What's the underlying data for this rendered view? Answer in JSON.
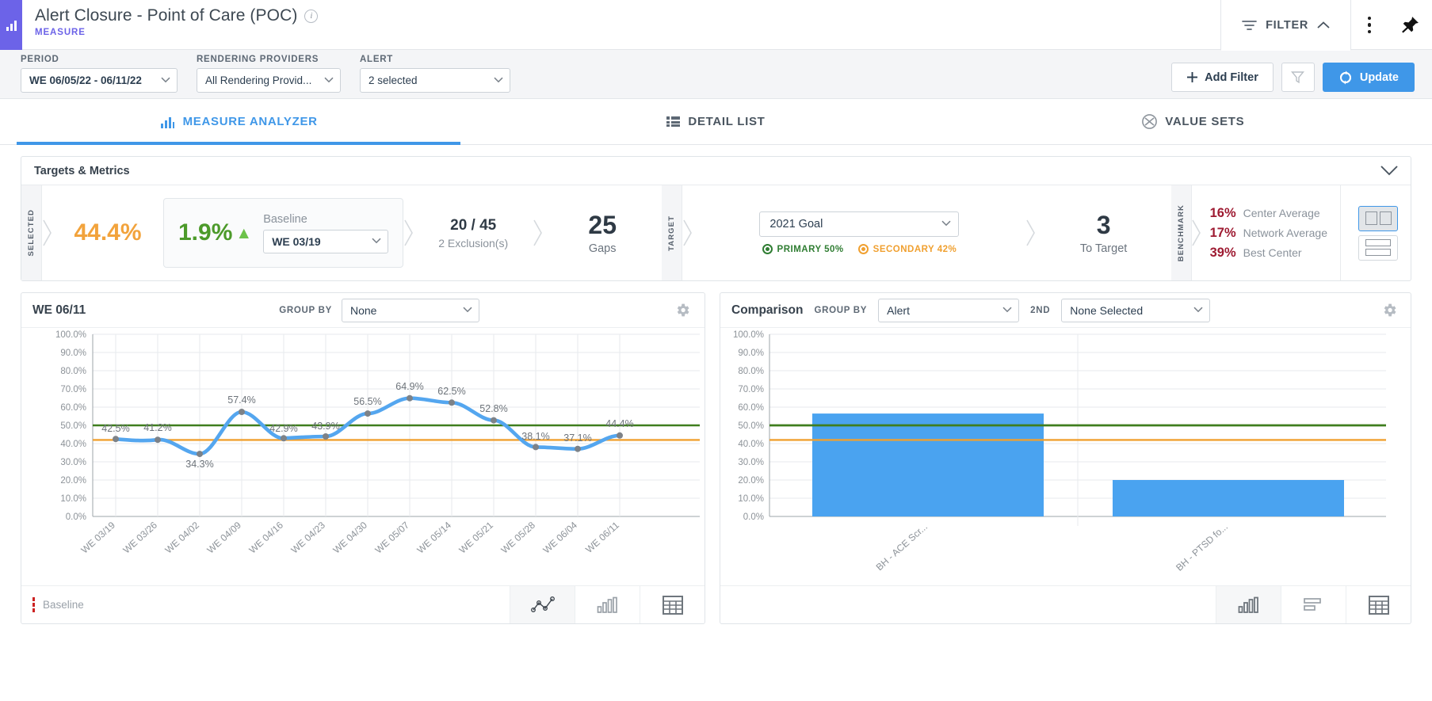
{
  "header": {
    "title": "Alert Closure - Point of Care (POC)",
    "subtitle": "MEASURE",
    "info_icon": "info-icon",
    "app_icon": "bar-chart-icon",
    "filter_tab_label": "FILTER",
    "filter_tab_icon": "filter-lines-icon",
    "filter_collapse_icon": "chevron-up-icon",
    "more_icon": "kebab-menu-icon",
    "pin_icon": "pin-icon"
  },
  "filterbar": {
    "period_label": "PERIOD",
    "period_value": "WE 06/05/22 - 06/11/22",
    "providers_label": "RENDERING PROVIDERS",
    "providers_value": "All Rendering Provid...",
    "alert_label": "ALERT",
    "alert_value": "2 selected",
    "add_filter_label": "Add Filter",
    "add_filter_icon": "plus-icon",
    "funnel_icon": "funnel-icon",
    "update_label": "Update",
    "update_icon": "refresh-icon"
  },
  "tabs": [
    {
      "label": "MEASURE ANALYZER",
      "icon": "bar-chart-icon",
      "active": true
    },
    {
      "label": "DETAIL LIST",
      "icon": "list-icon",
      "active": false
    },
    {
      "label": "VALUE SETS",
      "icon": "value-sets-icon",
      "active": false
    }
  ],
  "targets": {
    "panel_title": "Targets & Metrics",
    "collapse_icon": "chevron-down-icon",
    "selected_tab": "SELECTED",
    "selected_value": "44.4%",
    "delta_value": "1.9%",
    "delta_direction": "up",
    "baseline_label": "Baseline",
    "baseline_value": "WE 03/19",
    "ratio_main": "20 / 45",
    "ratio_sub": "2 Exclusion(s)",
    "gaps_main": "25",
    "gaps_sub": "Gaps",
    "target_tab": "TARGET",
    "goal_value": "2021 Goal",
    "primary_label": "PRIMARY 50%",
    "secondary_label": "SECONDARY 42%",
    "to_target_main": "3",
    "to_target_sub": "To Target",
    "benchmark_tab": "BENCHMARK",
    "benchmarks": [
      {
        "pct": "16%",
        "label": "Center Average"
      },
      {
        "pct": "17%",
        "label": "Network Average"
      },
      {
        "pct": "39%",
        "label": "Best Center"
      }
    ],
    "layout_cols_icon": "layout-columns-icon",
    "layout_rows_icon": "layout-rows-icon"
  },
  "left_chart": {
    "title": "WE 06/11",
    "group_by_label": "GROUP BY",
    "group_by_value": "None",
    "gear_icon": "gear-icon",
    "footer_legend": "Baseline",
    "footer_legend_icon": "baseline-marker-icon",
    "view_line_icon": "line-chart-icon",
    "view_bar_icon": "bar-chart-icon",
    "view_table_icon": "table-icon"
  },
  "right_chart": {
    "title": "Comparison",
    "group_by_label": "GROUP BY",
    "group_by_value": "Alert",
    "second_label": "2ND",
    "second_value": "None Selected",
    "gear_icon": "gear-icon",
    "view_bar_icon": "bar-chart-icon",
    "view_hbar_icon": "horizontal-bar-icon",
    "view_table_icon": "table-icon"
  },
  "colors": {
    "accent": "#6c63e8",
    "primary_blue": "#3f97e8",
    "series_line": "#54a6ef",
    "primary_goal_line": "#3f7e1e",
    "secondary_goal_line": "#f0a030",
    "orange_value": "#f2a33c",
    "green_delta": "#4c9a2a",
    "benchmark_red": "#9e1b32"
  },
  "chart_data": [
    {
      "type": "line",
      "title": "WE 06/11",
      "xlabel": "",
      "ylabel": "",
      "ylim": [
        0,
        100
      ],
      "ytick_labels": [
        "100.0%",
        "90.0%",
        "80.0%",
        "70.0%",
        "60.0%",
        "50.0%",
        "40.0%",
        "30.0%",
        "20.0%",
        "10.0%",
        "0.0%"
      ],
      "grid": true,
      "categories": [
        "WE 03/19",
        "WE 03/26",
        "WE 04/02",
        "WE 04/09",
        "WE 04/16",
        "WE 04/23",
        "WE 04/30",
        "WE 05/07",
        "WE 05/14",
        "WE 05/21",
        "WE 05/28",
        "WE 06/04",
        "WE 06/11"
      ],
      "values": [
        42.5,
        41.2,
        34.3,
        57.4,
        42.9,
        43.9,
        56.5,
        64.9,
        62.5,
        52.8,
        38.1,
        37.1,
        44.4
      ],
      "data_labels": [
        "42.5%",
        "41.2%",
        "34.3%",
        "57.4%",
        "42.9%",
        "43.9%",
        "56.5%",
        "64.9%",
        "62.5%",
        "52.8%",
        "38.1%",
        "37.1%",
        "44.4%"
      ],
      "reference_lines": [
        {
          "name": "PRIMARY 50%",
          "value": 50,
          "color": "#3f7e1e"
        },
        {
          "name": "SECONDARY 42%",
          "value": 42,
          "color": "#f0a030"
        }
      ],
      "legend": [
        "Baseline"
      ]
    },
    {
      "type": "bar",
      "title": "Comparison",
      "xlabel": "",
      "ylabel": "",
      "ylim": [
        0,
        100
      ],
      "ytick_labels": [
        "100.0%",
        "90.0%",
        "80.0%",
        "70.0%",
        "60.0%",
        "50.0%",
        "40.0%",
        "30.0%",
        "20.0%",
        "10.0%",
        "0.0%"
      ],
      "grid": true,
      "categories": [
        "BH - ACE Scr...",
        "BH - PTSD fo..."
      ],
      "values": [
        56.5,
        20.0
      ],
      "reference_lines": [
        {
          "name": "PRIMARY 50%",
          "value": 50,
          "color": "#3f7e1e"
        },
        {
          "name": "SECONDARY 42%",
          "value": 42,
          "color": "#f0a030"
        }
      ]
    }
  ]
}
